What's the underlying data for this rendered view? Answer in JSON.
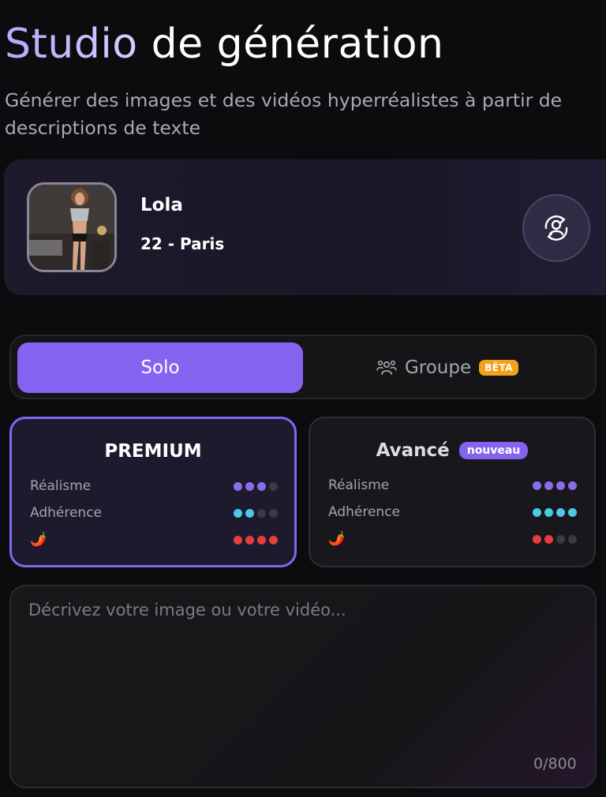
{
  "header": {
    "title_accent": "Studio",
    "title_rest": " de génération",
    "subtitle": "Générer des images et des vidéos hyperréalistes à partir de descriptions de texte"
  },
  "character": {
    "name": "Lola",
    "info": "22 - Paris",
    "swap_icon": "user-swap-icon"
  },
  "mode_toggle": {
    "solo_label": "Solo",
    "group_label": "Groupe",
    "group_badge": "BÊTA",
    "group_icon": "people-icon",
    "selected": "Solo"
  },
  "models": [
    {
      "title": "PREMIUM",
      "badge": "",
      "selected": true,
      "rows": [
        {
          "label": "Réalisme",
          "level": 3,
          "max": 4,
          "color": "#8b6cf0"
        },
        {
          "label": "Adhérence",
          "level": 2,
          "max": 4,
          "color": "#4cc9e8"
        },
        {
          "label": "🌶️",
          "level": 4,
          "max": 4,
          "color": "#e53e3e"
        }
      ]
    },
    {
      "title": "Avancé",
      "badge": "nouveau",
      "selected": false,
      "rows": [
        {
          "label": "Réalisme",
          "level": 4,
          "max": 4,
          "color": "#8b6cf0"
        },
        {
          "label": "Adhérence",
          "level": 4,
          "max": 4,
          "color": "#4cc9e8"
        },
        {
          "label": "🌶️",
          "level": 2,
          "max": 4,
          "color": "#e53e3e"
        }
      ]
    }
  ],
  "prompt": {
    "value": "",
    "placeholder": "Décrivez votre image ou votre vidéo...",
    "counter": "0/800"
  },
  "colors": {
    "accent": "#8563f0",
    "beta_badge": "#f1a21a",
    "empty_dot": "#3a3a42"
  }
}
